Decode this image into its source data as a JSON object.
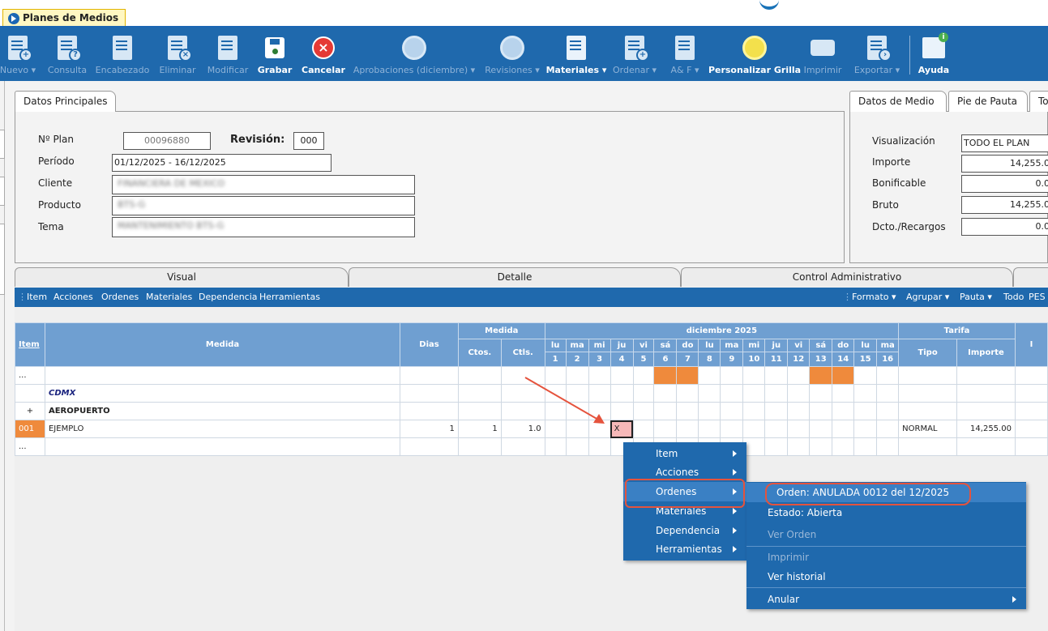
{
  "window": {
    "tab_title": "Planes de Medios"
  },
  "toolbar": {
    "buttons": [
      {
        "label": "Nuevo ▾",
        "icon": "new-doc-icon",
        "enabled": false
      },
      {
        "label": "Consulta",
        "icon": "query-doc-icon",
        "enabled": false
      },
      {
        "label": "Encabezado",
        "icon": "header-doc-icon",
        "enabled": false
      },
      {
        "label": "Eliminar",
        "icon": "delete-doc-icon",
        "enabled": false
      },
      {
        "label": "Modificar",
        "icon": "edit-doc-icon",
        "enabled": false
      },
      {
        "label": "Grabar",
        "icon": "save-icon",
        "enabled": true
      },
      {
        "label": "Cancelar",
        "icon": "cancel-icon",
        "enabled": true
      },
      {
        "label": "Aprobaciones (diciembre) ▾",
        "icon": "approvals-icon",
        "enabled": false
      },
      {
        "label": "Revisiones ▾",
        "icon": "revisions-icon",
        "enabled": false
      },
      {
        "label": "Materiales ▾",
        "icon": "materials-icon",
        "enabled": true
      },
      {
        "label": "Ordenar ▾",
        "icon": "order-icon",
        "enabled": false
      },
      {
        "label": "A& F ▾",
        "icon": "af-icon",
        "enabled": false
      },
      {
        "label": "Personalizar Grilla",
        "icon": "grid-customize-icon",
        "enabled": true
      },
      {
        "label": "Imprimir",
        "icon": "printer-icon",
        "enabled": false
      },
      {
        "label": "Exportar ▾",
        "icon": "export-icon",
        "enabled": false
      },
      {
        "label": "Ayuda",
        "icon": "help-book-icon",
        "enabled": true
      }
    ]
  },
  "datos_principales": {
    "tab": "Datos Principales",
    "plan_label": "Nº Plan",
    "plan_value": "00096880",
    "revision_label": "Revisión:",
    "revision_value": "000",
    "periodo_label": "Período",
    "periodo_value": "01/12/2025 - 16/12/2025",
    "cliente_label": "Cliente",
    "cliente_value": "FINANCIERA DE MEXICO",
    "producto_label": "Producto",
    "producto_value": "BTS-G",
    "tema_label": "Tema",
    "tema_value": "MANTENIMIENTO BTS-G"
  },
  "datos_medio": {
    "tabs": [
      "Datos de Medio",
      "Pie de Pauta",
      "To"
    ],
    "visualizacion_label": "Visualización",
    "visualizacion_value": "TODO EL PLAN",
    "importe_label": "Importe",
    "importe_value": "14,255.0",
    "bonificable_label": "Bonificable",
    "bonificable_value": "0.0",
    "bruto_label": "Bruto",
    "bruto_value": "14,255.0",
    "dcto_label": "Dcto./Recargos",
    "dcto_value": "0.0"
  },
  "view_tabs": [
    "Visual",
    "Detalle",
    "Control Administrativo"
  ],
  "menubar": {
    "left": [
      "Item",
      "Acciones",
      "Ordenes",
      "Materiales",
      "Dependencia",
      "Herramientas"
    ],
    "right": [
      "Formato ▾",
      "Agrupar ▾",
      "Pauta ▾",
      "Todo",
      "PES"
    ]
  },
  "grid": {
    "headers": {
      "item": "Item",
      "medida": "Medida",
      "dias": "Dias",
      "medida_group": "Medida",
      "ctos": "Ctos.",
      "ctls": "Ctls.",
      "month": "diciembre 2025",
      "tarifa": "Tarifa",
      "tipo": "Tipo",
      "importe": "Importe",
      "last": "I"
    },
    "day_names": [
      "lu",
      "ma",
      "mi",
      "ju",
      "vi",
      "sá",
      "do",
      "lu",
      "ma",
      "mi",
      "ju",
      "vi",
      "sá",
      "do",
      "lu",
      "ma"
    ],
    "day_numbers": [
      "1",
      "2",
      "3",
      "4",
      "5",
      "6",
      "7",
      "8",
      "9",
      "10",
      "11",
      "12",
      "13",
      "14",
      "15",
      "16"
    ],
    "rows": {
      "r0_item": "...",
      "r1_medida": "CDMX",
      "r2_item": "+",
      "r2_medida": "AEROPUERTO",
      "r3_item": "001",
      "r3_medida": "EJEMPLO",
      "r3_dias": "1",
      "r3_ctos": "1",
      "r3_ctls": "1.0",
      "r3_mark": "X",
      "r3_tipo": "NORMAL",
      "r3_importe": "14,255.00",
      "r4_item": "..."
    }
  },
  "context_menu": {
    "items": [
      "Item",
      "Acciones",
      "Ordenes",
      "Materiales",
      "Dependencia",
      "Herramientas"
    ]
  },
  "submenu": {
    "items": [
      "Orden: ANULADA 0012 del 12/2025",
      "Estado: Abierta",
      "Ver Orden",
      "Imprimir",
      "Ver historial",
      "Anular"
    ]
  },
  "colors": {
    "toolbar_blue": "#1f69ad",
    "header_blue": "#6f9fd1",
    "weekend_orange": "#ef8a3c",
    "annotation_red": "#e5533d"
  }
}
